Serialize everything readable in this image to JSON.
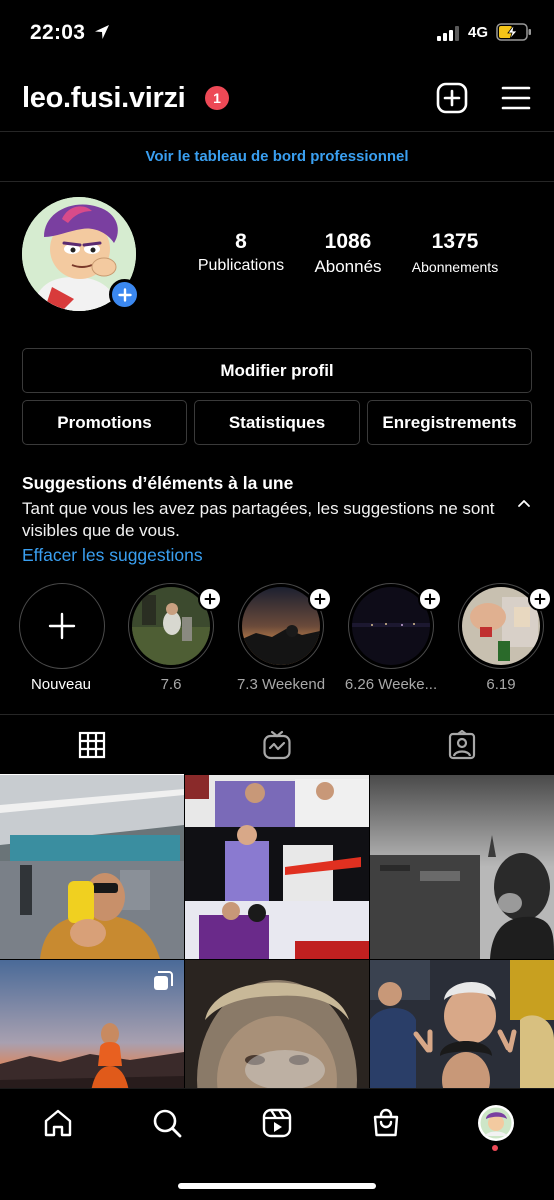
{
  "status_bar": {
    "time": "22:03",
    "network": "4G"
  },
  "header": {
    "username": "leo.fusi.virzi",
    "notification_count": "1"
  },
  "pro_banner": {
    "label": "Voir le tableau de bord professionnel"
  },
  "stats": [
    {
      "value": "8",
      "label": "Publications"
    },
    {
      "value": "1086",
      "label": "Abonnés"
    },
    {
      "value": "1375",
      "label": "Abonnements"
    }
  ],
  "buttons": {
    "edit_profile": "Modifier profil",
    "promotions": "Promotions",
    "statistics": "Statistiques",
    "saved": "Enregistrements"
  },
  "suggestions": {
    "title": "Suggestions d’éléments à la une",
    "text": "Tant que vous les avez pas partagées, les suggestions ne sont visibles que de vous.",
    "clear": "Effacer les suggestions"
  },
  "highlights": [
    {
      "label": "Nouveau"
    },
    {
      "label": "7.6"
    },
    {
      "label": "7.3 Weekend"
    },
    {
      "label": "6.26 Weeke..."
    },
    {
      "label": "6.19"
    }
  ],
  "tabs": {
    "active": "grid"
  },
  "colors": {
    "accent": "#3a9ff0",
    "badge": "#ed4956",
    "add": "#3b88f0",
    "background": "#000000"
  }
}
